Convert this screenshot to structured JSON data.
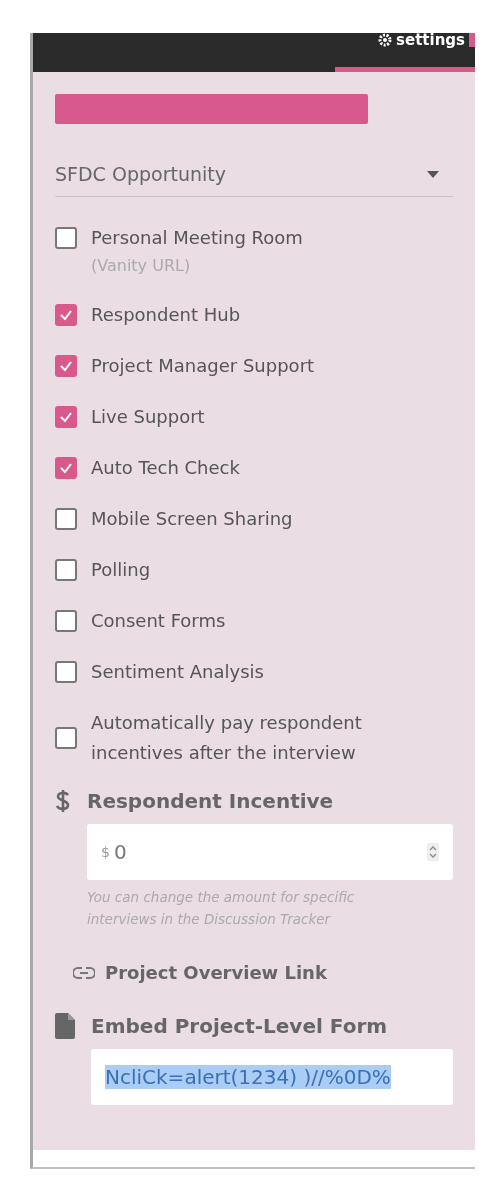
{
  "header": {
    "settings_label": "settings"
  },
  "dropdown": {
    "value": "SFDC Opportunity"
  },
  "options": [
    {
      "label": "Personal Meeting Room",
      "sublabel": "(Vanity URL)",
      "checked": false
    },
    {
      "label": "Respondent Hub",
      "checked": true
    },
    {
      "label": "Project Manager Support",
      "checked": true
    },
    {
      "label": "Live Support",
      "checked": true
    },
    {
      "label": "Auto Tech Check",
      "checked": true
    },
    {
      "label": "Mobile Screen Sharing",
      "checked": false
    },
    {
      "label": "Polling",
      "checked": false
    },
    {
      "label": "Consent Forms",
      "checked": false
    },
    {
      "label": "Sentiment Analysis",
      "checked": false
    },
    {
      "label": "Automatically pay respondent incentives after the interview",
      "checked": false
    }
  ],
  "incentive": {
    "title": "Respondent Incentive",
    "prefix": "$",
    "value": "0",
    "hint": "You can change the amount for specific interviews in the Discussion Tracker"
  },
  "overview_link": {
    "label": "Project Overview Link"
  },
  "embed_form": {
    "title": "Embed Project-Level Form",
    "value": "NcliCk=alert(1234) )//%0D%"
  }
}
